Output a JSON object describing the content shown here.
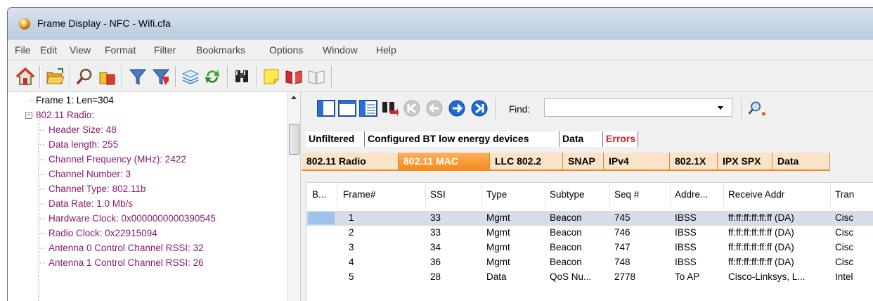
{
  "window": {
    "title": "Frame Display - NFC - Wifi.cfa"
  },
  "menu": [
    "File",
    "Edit",
    "View",
    "Format",
    "Filter",
    "Bookmarks",
    "Options",
    "Window",
    "Help"
  ],
  "toolbar_icons": [
    "home-icon",
    "open-folder-icon",
    "magnifier-icon",
    "key-icon",
    "filter-icon",
    "filter-red-icon",
    "layers-icon",
    "refresh-icon",
    "binoculars-icon",
    "sticky-note-icon",
    "book-red-icon",
    "book-gray-icon"
  ],
  "tree": [
    {
      "text": "Frame 1:  Len=304",
      "color": "#000000",
      "indent": 0
    },
    {
      "text": "802.11 Radio:",
      "color": "#8a1a70",
      "indent": 0
    },
    {
      "text": "Header Size: 48",
      "color": "#8a1a70",
      "indent": 1
    },
    {
      "text": "Data length: 255",
      "color": "#8a1a70",
      "indent": 1
    },
    {
      "text": "Channel Frequency (MHz): 2422",
      "color": "#8a1a70",
      "indent": 1
    },
    {
      "text": "Channel Number: 3",
      "color": "#8a1a70",
      "indent": 1
    },
    {
      "text": "Channel Type: 802.11b",
      "color": "#8a1a70",
      "indent": 1
    },
    {
      "text": "Data Rate: 1.0 Mb/s",
      "color": "#8a1a70",
      "indent": 1
    },
    {
      "text": "Hardware Clock: 0x0000000000390545",
      "color": "#8a1a70",
      "indent": 1
    },
    {
      "text": "Radio Clock: 0x22915094",
      "color": "#8a1a70",
      "indent": 1
    },
    {
      "text": "Antenna 0 Control Channel RSSI: 32",
      "color": "#8a1a70",
      "indent": 1
    },
    {
      "text": "Antenna 1 Control Channel RSSI: 26",
      "color": "#8a1a70",
      "indent": 1
    }
  ],
  "find": {
    "label": "Find:",
    "value": ""
  },
  "view_tabs": [
    "Unfiltered",
    "Configured BT low energy devices",
    "Data",
    "Errors"
  ],
  "protocol_tabs": [
    "802.11 Radio",
    "802.11 MAC",
    "LLC 802.2",
    "SNAP",
    "IPv4",
    "802.1X",
    "IPX SPX",
    "Data"
  ],
  "protocol_tab_active": "802.11 MAC",
  "columns": [
    "B...",
    "Frame#",
    "SSI",
    "Type",
    "Subtype",
    "Seq #",
    "Addre...",
    "Receive Addr",
    "Tran"
  ],
  "rows": [
    [
      "",
      "1",
      "33",
      "Mgmt",
      "Beacon",
      "745",
      "IBSS",
      "ff:ff:ff:ff:ff:ff  (DA)",
      "Cisc"
    ],
    [
      "",
      "2",
      "33",
      "Mgmt",
      "Beacon",
      "746",
      "IBSS",
      "ff:ff:ff:ff:ff:ff  (DA)",
      "Cisc"
    ],
    [
      "",
      "3",
      "34",
      "Mgmt",
      "Beacon",
      "747",
      "IBSS",
      "ff:ff:ff:ff:ff:ff  (DA)",
      "Cisc"
    ],
    [
      "",
      "4",
      "36",
      "Mgmt",
      "Beacon",
      "748",
      "IBSS",
      "ff:ff:ff:ff:ff:ff  (DA)",
      "Cisc"
    ],
    [
      "",
      "5",
      "28",
      "Data",
      "QoS Nu...",
      "2778",
      "To AP",
      "Cisco-Linksys, L...",
      "Intel"
    ]
  ],
  "selected_row": 0
}
